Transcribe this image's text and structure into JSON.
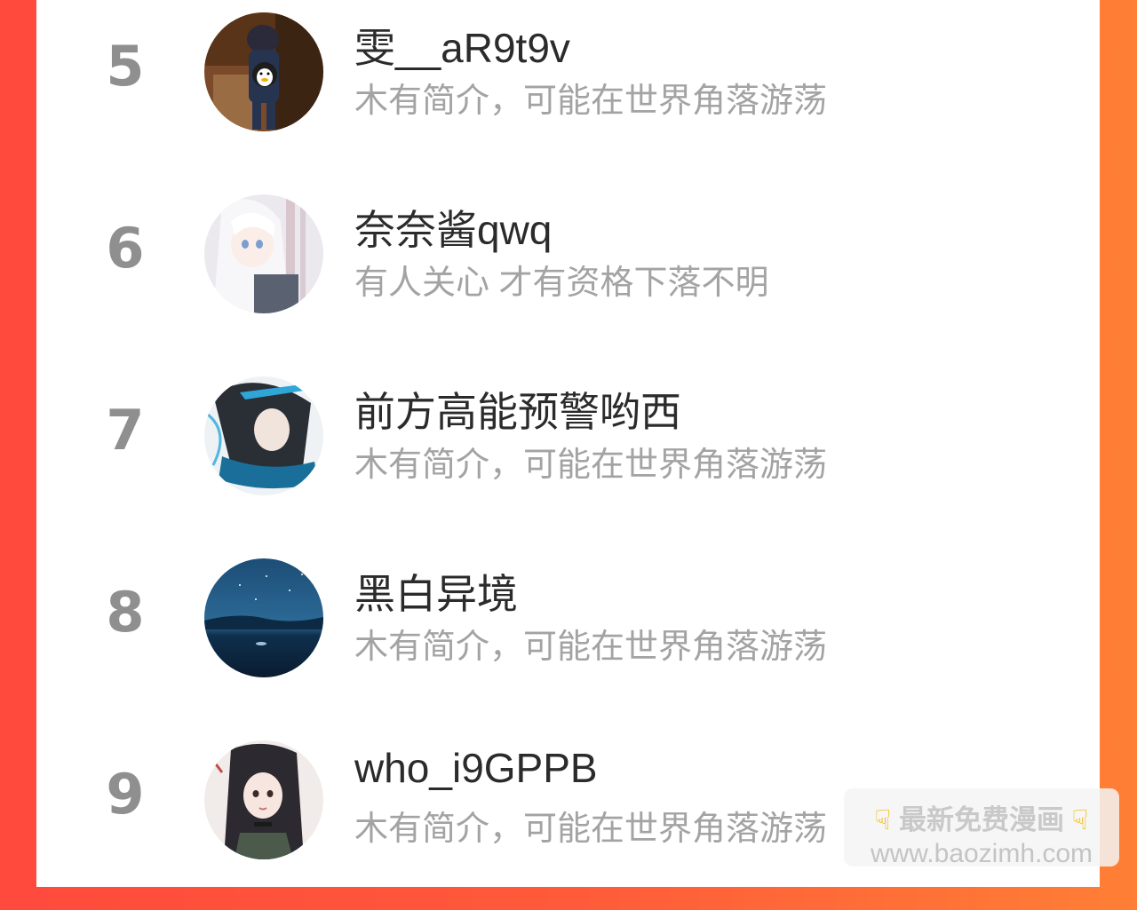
{
  "users": [
    {
      "rank": "5",
      "name": "雯__aR9t9v",
      "bio": "木有简介，可能在世界角落游荡",
      "avatar": "toddler-penguin-photo"
    },
    {
      "rank": "6",
      "name": "奈奈酱qwq",
      "bio": "有人关心 才有资格下落不明",
      "avatar": "white-hair-anime-girl"
    },
    {
      "rank": "7",
      "name": "前方高能预警哟西",
      "bio": "木有简介，可能在世界角落游荡",
      "avatar": "dark-hair-anime-boy"
    },
    {
      "rank": "8",
      "name": "黑白异境",
      "bio": "木有简介，可能在世界角落游荡",
      "avatar": "night-sky-ocean"
    },
    {
      "rank": "9",
      "name": "who_i9GPPB",
      "bio": "木有简介，可能在世界角落游荡",
      "avatar": "anime-girl-long-hair"
    }
  ],
  "watermark": {
    "title": "最新免费漫画",
    "url": "www.baozimh.com",
    "icon": "pointing-down-icon"
  }
}
